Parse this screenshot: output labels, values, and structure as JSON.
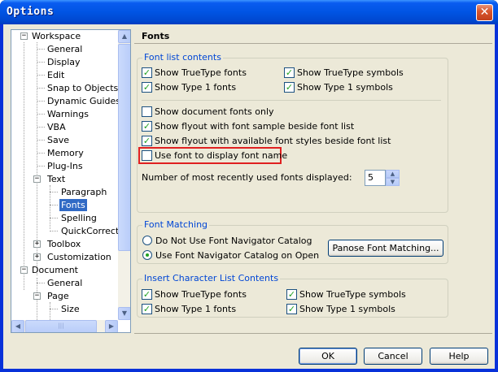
{
  "window": {
    "title": "Options",
    "close_glyph": "✕"
  },
  "tree": {
    "items": [
      {
        "label": "Workspace"
      },
      {
        "label": "General"
      },
      {
        "label": "Display"
      },
      {
        "label": "Edit"
      },
      {
        "label": "Snap to Objects"
      },
      {
        "label": "Dynamic Guides"
      },
      {
        "label": "Warnings"
      },
      {
        "label": "VBA"
      },
      {
        "label": "Save"
      },
      {
        "label": "Memory"
      },
      {
        "label": "Plug-Ins"
      },
      {
        "label": "Text"
      },
      {
        "label": "Paragraph"
      },
      {
        "label": "Fonts"
      },
      {
        "label": "Spelling"
      },
      {
        "label": "QuickCorrect"
      },
      {
        "label": "Toolbox"
      },
      {
        "label": "Customization"
      },
      {
        "label": "Document"
      },
      {
        "label": "General"
      },
      {
        "label": "Page"
      },
      {
        "label": "Size"
      }
    ],
    "expand_minus": "−",
    "expand_plus": "+",
    "scroll_up": "▲",
    "scroll_down": "▼",
    "scroll_left": "◀",
    "scroll_right": "▶",
    "grip": "|||"
  },
  "panel": {
    "title": "Fonts",
    "font_list": {
      "title": "Font list contents",
      "show_truetype_fonts": "Show TrueType fonts",
      "show_truetype_symbols": "Show TrueType symbols",
      "show_type1_fonts": "Show Type 1 fonts",
      "show_type1_symbols": "Show Type 1 symbols",
      "show_document_fonts": "Show document fonts only",
      "show_flyout_sample": "Show flyout with font sample beside font list",
      "show_flyout_styles": "Show flyout with available font styles beside font list",
      "use_font_display": "Use font to display font name",
      "recent_label": "Number of most recently used fonts displayed:",
      "recent_value": "5"
    },
    "font_matching": {
      "title": "Font Matching",
      "no_navigator": "Do Not Use Font Navigator Catalog",
      "use_navigator": "Use Font Navigator Catalog on Open",
      "panose_button": "Panose Font Matching..."
    },
    "insert_char": {
      "title": "Insert Character List Contents",
      "show_truetype_fonts": "Show TrueType fonts",
      "show_truetype_symbols": "Show TrueType symbols",
      "show_type1_fonts": "Show Type 1 fonts",
      "show_type1_symbols": "Show Type 1 symbols"
    },
    "check_glyph": "✓"
  },
  "footer": {
    "ok": "OK",
    "cancel": "Cancel",
    "help": "Help"
  },
  "colors": {
    "highlight_box": "#e02020",
    "group_title": "#0046d5",
    "selection": "#316ac5",
    "title_bar": "#0054e3"
  }
}
